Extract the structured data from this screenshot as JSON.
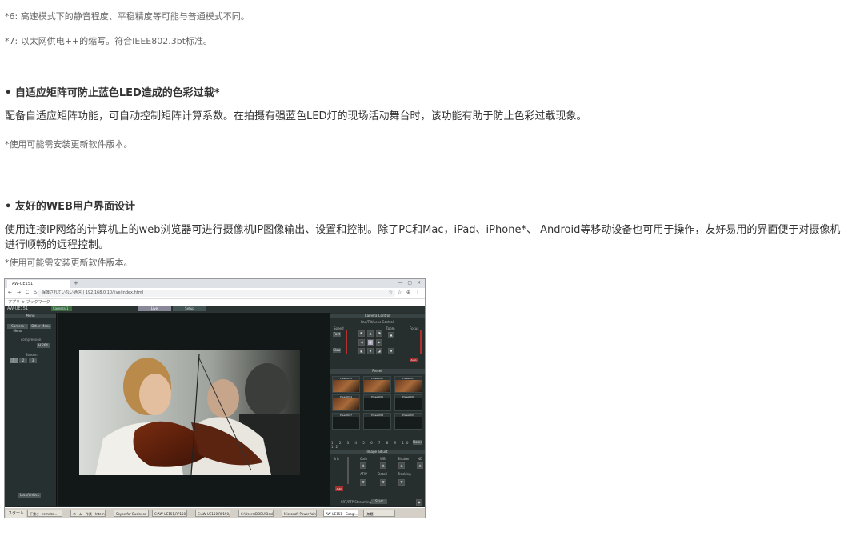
{
  "notes": {
    "n6": "*6: 高速模式下的静音程度、平稳精度等可能与普通模式不同。",
    "n7": "*7: 以太网供电++的缩写。符合IEEE802.3bt标准。"
  },
  "section1": {
    "heading": "• 自适应矩阵可防止蓝色LED造成的色彩过载*",
    "body": "配备自适应矩阵功能，可自动控制矩阵计算系数。在拍摄有强蓝色LED灯的现场活动舞台时，该功能有助于防止色彩过载现象。",
    "note": "*使用可能需安装更新软件版本。"
  },
  "section2": {
    "heading": "• 友好的WEB用户界面设计",
    "body": "使用连接IP网络的计算机上的web浏览器可进行摄像机IP图像输出、设置和控制。除了PC和Mac，iPad、iPhone*、 Android等移动设备也可用于操作，友好易用的界面便于对摄像机进行顺畅的远程控制。",
    "note": "*使用可能需安装更新软件版本。"
  },
  "screenshot": {
    "browser": {
      "tab_title": "AW-UE151",
      "new_tab": "+",
      "window_buttons": "— ▢ ✕",
      "nav": "← → C ⌂",
      "url": "保護されていない通信 | 192.168.0.10/live/index.html",
      "addr_icons": "☆ ☆ ⊕ ⋮",
      "bookmarks": "アプリ   ★ ブックマーク"
    },
    "app": {
      "model": "AW-UE151",
      "camera_select": "Camera 1",
      "tabs": [
        "Live",
        "Setup"
      ],
      "left_panel": {
        "title": "Menu",
        "buttons": [
          "Camera Menu",
          "Other Menu"
        ],
        "compression_label": "compression",
        "compression_value": "H.264",
        "stream_label": "Stream",
        "stream_values": [
          "1",
          "2",
          "3"
        ],
        "bottom_button": "Lock/Unlock"
      },
      "right_panel": {
        "title": "Camera Control",
        "pan_tilt_title": "Pan/Tilt/Lens Control",
        "labels": [
          "Speed",
          "Zoom",
          "Focus"
        ],
        "fast": "Fast",
        "slow": "Slow",
        "auto": "Auto",
        "preset_title": "Preset",
        "presets": [
          "Preset001",
          "Preset002",
          "Preset003",
          "Preset004",
          "Preset005",
          "Preset006",
          "Preset007",
          "Preset008",
          "Preset009"
        ],
        "pages": "1 2 3 4 5 6 7 8 9 10 11 12",
        "home": "Home",
        "image_adjust_title": "Image adjust",
        "image_labels": [
          "Iris",
          "Gain",
          "WB",
          "Shutter",
          "ND"
        ],
        "image_labels2": [
          "",
          "ATW",
          "Detail",
          "Tracking"
        ],
        "srt_label": "SRT/RTP Streaming",
        "srt_value": "Start"
      }
    },
    "taskbar": {
      "start": "スタート",
      "items": [
        "下書き - remote...",
        "ホーム - 作業 - Internet...",
        "Skype for Business",
        "C:AW-UE151,RP150,...",
        "C:AW-UE150,RP150,A...",
        "C:\\Users\\DOBU\\Desk...",
        "Microsoft PowerPoint...",
        "AW-UE151 - Googl...",
        "(無題)"
      ]
    }
  }
}
